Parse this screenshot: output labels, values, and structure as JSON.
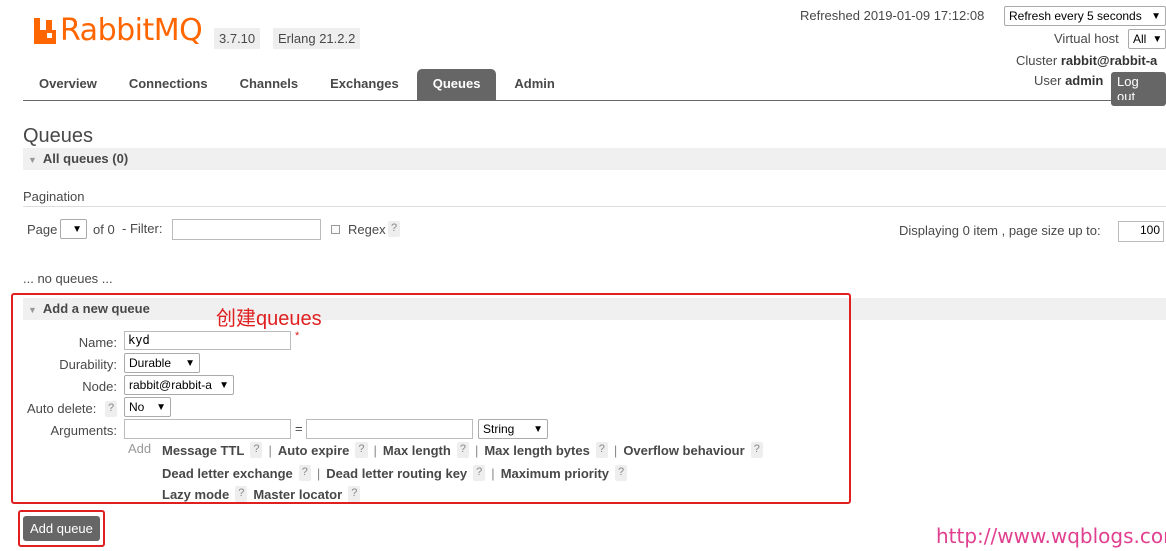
{
  "header": {
    "logo_text": "RabbitMQ",
    "version": "3.7.10",
    "erlang": "Erlang 21.2.2",
    "refreshed": "Refreshed 2019-01-09 17:12:08",
    "refresh_select": "Refresh every 5 seconds",
    "vhost_label": "Virtual host",
    "vhost_select": "All",
    "cluster_label": "Cluster",
    "cluster_name": "rabbit@rabbit-a",
    "user_label": "User",
    "user_name": "admin",
    "logout": "Log out"
  },
  "tabs": [
    {
      "label": "Overview",
      "active": false
    },
    {
      "label": "Connections",
      "active": false
    },
    {
      "label": "Channels",
      "active": false
    },
    {
      "label": "Exchanges",
      "active": false
    },
    {
      "label": "Queues",
      "active": true
    },
    {
      "label": "Admin",
      "active": false
    }
  ],
  "page": {
    "title": "Queues",
    "all_queues": "All queues (0)",
    "pagination_label": "Pagination",
    "page_label": "Page",
    "of_label": "of 0",
    "filter_label": "- Filter:",
    "regex_label": "Regex",
    "displaying": "Displaying 0 item , page size up to:",
    "page_size": "100",
    "no_queues": "... no queues ..."
  },
  "add_queue": {
    "section_title": "Add a new queue",
    "annotation": "创建queues",
    "name_label": "Name:",
    "name_value": "kyd",
    "required_mark": "*",
    "durability_label": "Durability:",
    "durability_value": "Durable",
    "node_label": "Node:",
    "node_value": "rabbit@rabbit-a",
    "auto_delete_label": "Auto delete:",
    "auto_delete_value": "No",
    "arguments_label": "Arguments:",
    "equals": "=",
    "arg_type": "String",
    "add_label": "Add",
    "arg_links_row1": [
      "Message TTL",
      "Auto expire",
      "Max length",
      "Max length bytes",
      "Overflow behaviour"
    ],
    "arg_links_row2": [
      "Dead letter exchange",
      "Dead letter routing key",
      "Maximum priority"
    ],
    "arg_links_row3": [
      "Lazy mode",
      "Master locator"
    ],
    "help": "?",
    "separator": "|",
    "submit": "Add queue"
  },
  "watermark": "http://www.wqblogs.com",
  "colors": {
    "brand": "#ff6600",
    "annotation": "#e02020",
    "watermark": "#e0408f",
    "tab_active": "#666666"
  }
}
